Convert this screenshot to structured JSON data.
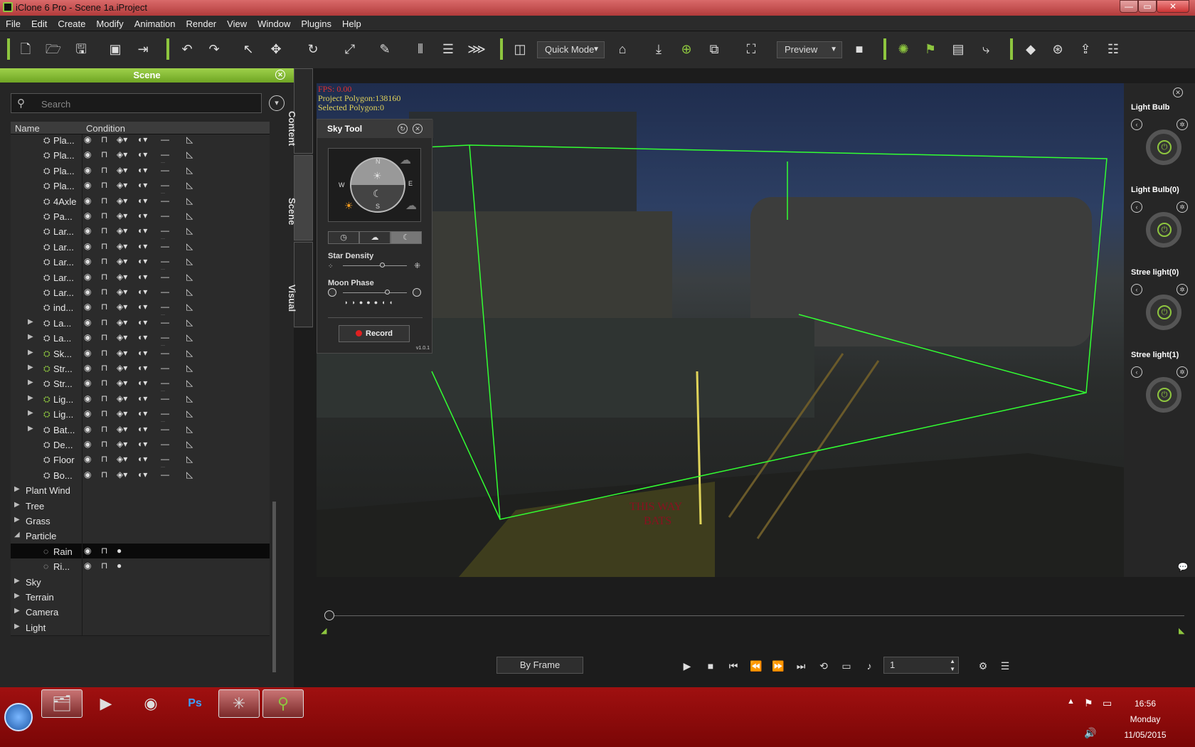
{
  "window": {
    "title": "iClone 6 Pro - Scene 1a.iProject",
    "controls": [
      "—",
      "▭",
      "✕"
    ]
  },
  "menu": [
    "File",
    "Edit",
    "Create",
    "Modify",
    "Animation",
    "Render",
    "View",
    "Window",
    "Plugins",
    "Help"
  ],
  "toolbar": {
    "mode_select": "Quick Mode",
    "quality_select": "Preview"
  },
  "scene_panel": {
    "title": "Scene",
    "search_placeholder": "Search",
    "col_name": "Name",
    "col_condition": "Condition",
    "rows": [
      {
        "name": "Pla...",
        "expand": "",
        "icon": "prop",
        "green": false
      },
      {
        "name": "Pla...",
        "expand": "",
        "icon": "prop",
        "green": false
      },
      {
        "name": "Pla...",
        "expand": "",
        "icon": "prop",
        "green": false
      },
      {
        "name": "Pla...",
        "expand": "",
        "icon": "prop",
        "green": false
      },
      {
        "name": "4Axle",
        "expand": "",
        "icon": "prop",
        "green": false
      },
      {
        "name": "Pa...",
        "expand": "",
        "icon": "prop",
        "green": false
      },
      {
        "name": "Lar...",
        "expand": "",
        "icon": "prop",
        "green": false
      },
      {
        "name": "Lar...",
        "expand": "",
        "icon": "prop",
        "green": false
      },
      {
        "name": "Lar...",
        "expand": "",
        "icon": "prop",
        "green": false
      },
      {
        "name": "Lar...",
        "expand": "",
        "icon": "prop",
        "green": false
      },
      {
        "name": "Lar...",
        "expand": "",
        "icon": "prop",
        "green": false
      },
      {
        "name": "ind...",
        "expand": "",
        "icon": "prop",
        "green": false
      },
      {
        "name": "La...",
        "expand": "▶",
        "icon": "prop",
        "green": false
      },
      {
        "name": "La...",
        "expand": "▶",
        "icon": "prop",
        "green": false
      },
      {
        "name": "Sk...",
        "expand": "▶",
        "icon": "prop",
        "green": true
      },
      {
        "name": "Str...",
        "expand": "▶",
        "icon": "prop",
        "green": true
      },
      {
        "name": "Str...",
        "expand": "▶",
        "icon": "prop",
        "green": false
      },
      {
        "name": "Lig...",
        "expand": "▶",
        "icon": "prop",
        "green": true
      },
      {
        "name": "Lig...",
        "expand": "▶",
        "icon": "prop",
        "green": true
      },
      {
        "name": "Bat...",
        "expand": "▶",
        "icon": "prop",
        "green": false
      },
      {
        "name": "De...",
        "expand": "",
        "icon": "prop",
        "green": false
      },
      {
        "name": "Floor",
        "expand": "",
        "icon": "prop",
        "green": false
      },
      {
        "name": "Bo...",
        "expand": "",
        "icon": "prop",
        "green": false
      }
    ],
    "groups": [
      "Plant Wind",
      "Tree",
      "Grass",
      "Particle"
    ],
    "particles": [
      "Rain",
      "Ri..."
    ],
    "groups2": [
      "Sky",
      "Terrain",
      "Camera",
      "Light"
    ]
  },
  "side_tabs": [
    "Content",
    "Scene",
    "Visual"
  ],
  "viewport": {
    "fps": "FPS: 0.00",
    "project_polygon": "Project Polygon:138160",
    "selected_polygon": "Selected Polygon:0"
  },
  "sky_tool": {
    "title": "Sky Tool",
    "compass": {
      "n": "N",
      "s": "S",
      "e": "E",
      "w": "W"
    },
    "star_density_label": "Star Density",
    "moon_phase_label": "Moon Phase",
    "record_label": "Record",
    "version": "v1.0.1"
  },
  "lights": [
    {
      "name": "Light Bulb"
    },
    {
      "name": "Light Bulb(0)"
    },
    {
      "name": "Stree light(0)"
    },
    {
      "name": "Stree light(1)"
    }
  ],
  "timeline": {
    "mode": "By Frame",
    "frame": "1"
  },
  "clock": {
    "time": "16:56",
    "day": "Monday",
    "date": "11/05/2015"
  }
}
